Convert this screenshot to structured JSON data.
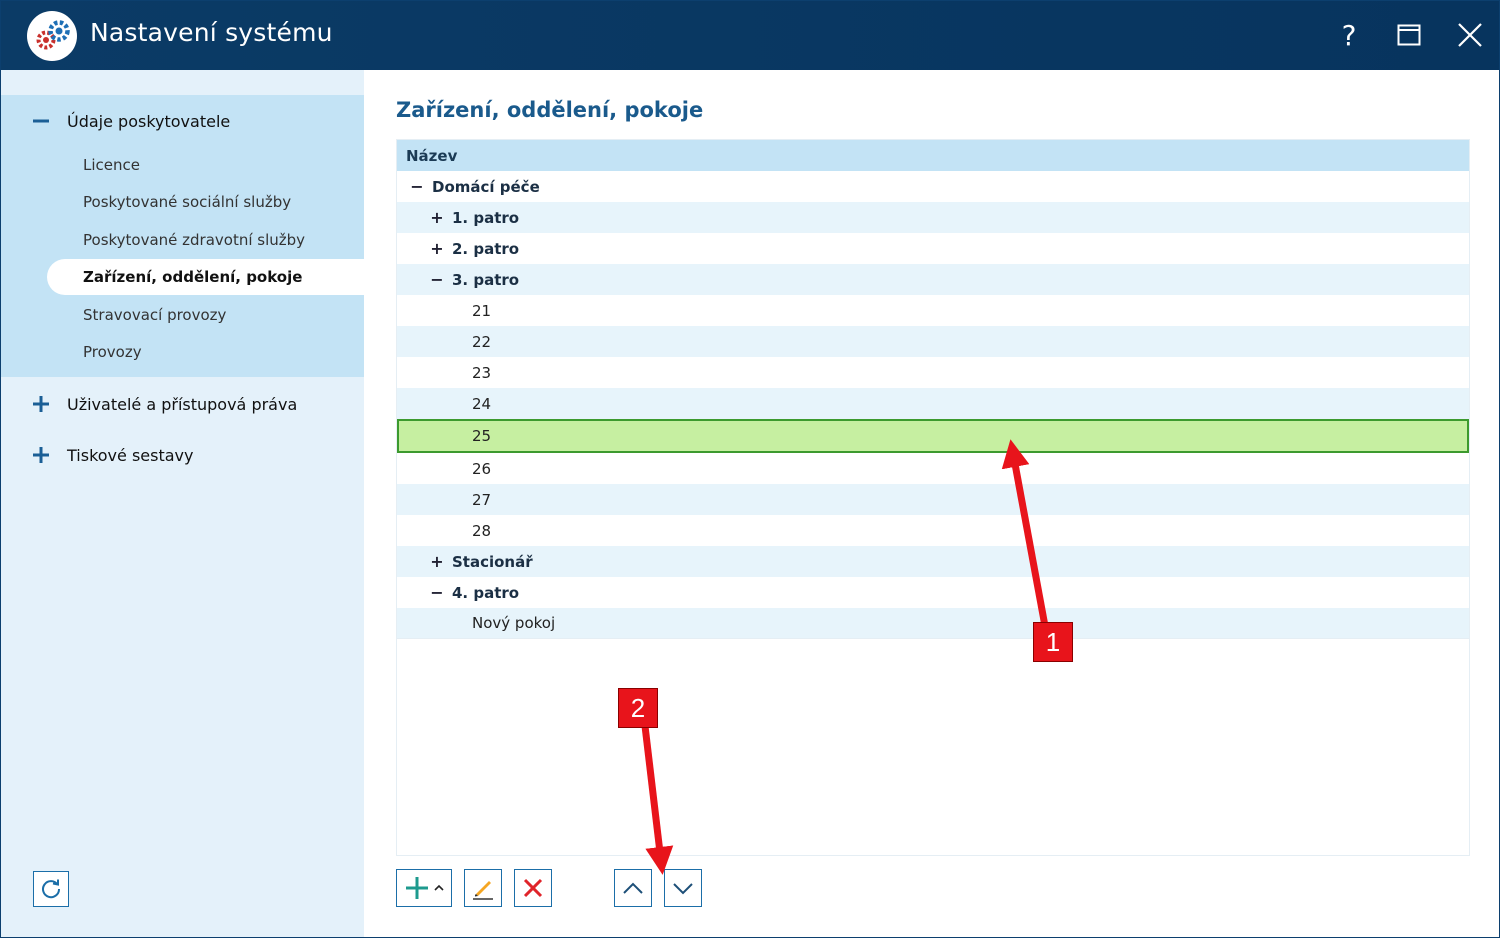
{
  "window": {
    "title": "Nastavení systému",
    "help_label": "?"
  },
  "sidebar": {
    "groups": [
      {
        "label": "Údaje poskytovatele",
        "expanded": true,
        "items": [
          {
            "label": "Licence"
          },
          {
            "label": "Poskytované sociální služby"
          },
          {
            "label": "Poskytované zdravotní služby"
          },
          {
            "label": "Zařízení, oddělení, pokoje",
            "active": true
          },
          {
            "label": "Stravovací provozy"
          },
          {
            "label": "Provozy"
          }
        ]
      },
      {
        "label": "Uživatelé a přístupová práva",
        "expanded": false
      },
      {
        "label": "Tiskové sestavy",
        "expanded": false
      }
    ]
  },
  "main": {
    "title": "Zařízení, oddělení, pokoje",
    "tree": {
      "column_header": "Název",
      "rows": [
        {
          "label": "Domácí péče",
          "toggle": "−",
          "level": 0,
          "bold": true
        },
        {
          "label": "1. patro",
          "toggle": "+",
          "level": 1,
          "bold": true
        },
        {
          "label": "2. patro",
          "toggle": "+",
          "level": 1,
          "bold": true
        },
        {
          "label": "3. patro",
          "toggle": "−",
          "level": 1,
          "bold": true
        },
        {
          "label": "21",
          "level": 2
        },
        {
          "label": "22",
          "level": 2
        },
        {
          "label": "23",
          "level": 2
        },
        {
          "label": "24",
          "level": 2
        },
        {
          "label": "25",
          "level": 2,
          "selected": true
        },
        {
          "label": "26",
          "level": 2
        },
        {
          "label": "27",
          "level": 2
        },
        {
          "label": "28",
          "level": 2
        },
        {
          "label": "Stacionář",
          "toggle": "+",
          "level": 1,
          "bold": true
        },
        {
          "label": "4. patro",
          "toggle": "−",
          "level": 1,
          "bold": true
        },
        {
          "label": "Nový pokoj",
          "level": 2
        }
      ]
    }
  },
  "annotations": [
    {
      "label": "1"
    },
    {
      "label": "2"
    }
  ],
  "colors": {
    "titlebar": "#0b3b66",
    "sidebar": "#e4f1fa",
    "sidebar_group": "#c3e3f5",
    "accent": "#1b6ea8",
    "selected_row": "#c6efa1",
    "selected_border": "#3c9a2e",
    "annotation": "#e8141b"
  }
}
